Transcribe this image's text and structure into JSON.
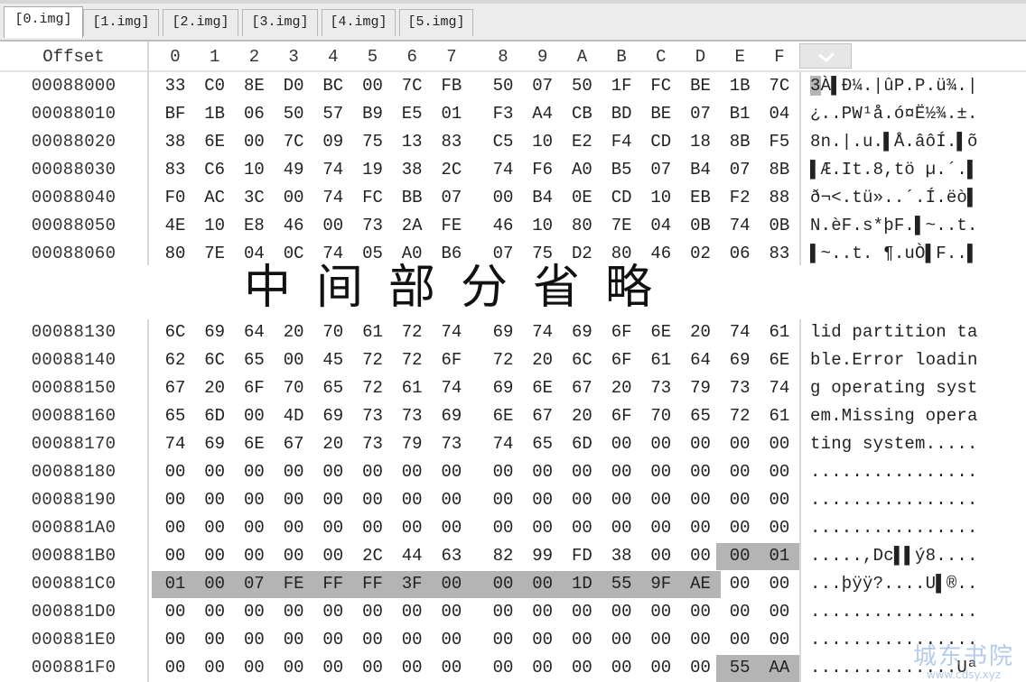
{
  "tabs": [
    {
      "label": "[0.img]",
      "active": true
    },
    {
      "label": "[1.img]",
      "active": false
    },
    {
      "label": "[2.img]",
      "active": false
    },
    {
      "label": "[3.img]",
      "active": false
    },
    {
      "label": "[4.img]",
      "active": false
    },
    {
      "label": "[5.img]",
      "active": false
    }
  ],
  "header": {
    "offset_label": "Offset",
    "columns": [
      "0",
      "1",
      "2",
      "3",
      "4",
      "5",
      "6",
      "7",
      "8",
      "9",
      "A",
      "B",
      "C",
      "D",
      "E",
      "F"
    ],
    "menu_icon": "chevron-down-icon"
  },
  "top_rows": [
    {
      "offset": "00088000",
      "bytes": [
        "33",
        "C0",
        "8E",
        "D0",
        "BC",
        "00",
        "7C",
        "FB",
        "50",
        "07",
        "50",
        "1F",
        "FC",
        "BE",
        "1B",
        "7C"
      ],
      "ascii": "3À▌Ð¼.|ûP.P.ü¾.|"
    },
    {
      "offset": "00088010",
      "bytes": [
        "BF",
        "1B",
        "06",
        "50",
        "57",
        "B9",
        "E5",
        "01",
        "F3",
        "A4",
        "CB",
        "BD",
        "BE",
        "07",
        "B1",
        "04"
      ],
      "ascii": "¿..PW¹å.ó¤Ë½¾.±."
    },
    {
      "offset": "00088020",
      "bytes": [
        "38",
        "6E",
        "00",
        "7C",
        "09",
        "75",
        "13",
        "83",
        "C5",
        "10",
        "E2",
        "F4",
        "CD",
        "18",
        "8B",
        "F5"
      ],
      "ascii": "8n.|.u.▌Å.âôÍ.▌õ"
    },
    {
      "offset": "00088030",
      "bytes": [
        "83",
        "C6",
        "10",
        "49",
        "74",
        "19",
        "38",
        "2C",
        "74",
        "F6",
        "A0",
        "B5",
        "07",
        "B4",
        "07",
        "8B"
      ],
      "ascii": "▌Æ.It.8,tö µ.´.▌"
    },
    {
      "offset": "00088040",
      "bytes": [
        "F0",
        "AC",
        "3C",
        "00",
        "74",
        "FC",
        "BB",
        "07",
        "00",
        "B4",
        "0E",
        "CD",
        "10",
        "EB",
        "F2",
        "88"
      ],
      "ascii": "ð¬<.tü»..´.Í.ëò▌"
    },
    {
      "offset": "00088050",
      "bytes": [
        "4E",
        "10",
        "E8",
        "46",
        "00",
        "73",
        "2A",
        "FE",
        "46",
        "10",
        "80",
        "7E",
        "04",
        "0B",
        "74",
        "0B"
      ],
      "ascii": "N.èF.s*þF.▌~..t."
    },
    {
      "offset": "00088060",
      "bytes": [
        "80",
        "7E",
        "04",
        "0C",
        "74",
        "05",
        "A0",
        "B6",
        "07",
        "75",
        "D2",
        "80",
        "46",
        "02",
        "06",
        "83"
      ],
      "ascii": "▌~..t. ¶.uÒ▌F..▌"
    }
  ],
  "omitted_label": "中间部分省略",
  "bottom_rows": [
    {
      "offset": "00088130",
      "bytes": [
        "6C",
        "69",
        "64",
        "20",
        "70",
        "61",
        "72",
        "74",
        "69",
        "74",
        "69",
        "6F",
        "6E",
        "20",
        "74",
        "61"
      ],
      "ascii": "lid partition ta"
    },
    {
      "offset": "00088140",
      "bytes": [
        "62",
        "6C",
        "65",
        "00",
        "45",
        "72",
        "72",
        "6F",
        "72",
        "20",
        "6C",
        "6F",
        "61",
        "64",
        "69",
        "6E"
      ],
      "ascii": "ble.Error loadin"
    },
    {
      "offset": "00088150",
      "bytes": [
        "67",
        "20",
        "6F",
        "70",
        "65",
        "72",
        "61",
        "74",
        "69",
        "6E",
        "67",
        "20",
        "73",
        "79",
        "73",
        "74"
      ],
      "ascii": "g operating syst"
    },
    {
      "offset": "00088160",
      "bytes": [
        "65",
        "6D",
        "00",
        "4D",
        "69",
        "73",
        "73",
        "69",
        "6E",
        "67",
        "20",
        "6F",
        "70",
        "65",
        "72",
        "61"
      ],
      "ascii": "em.Missing opera"
    },
    {
      "offset": "00088170",
      "bytes": [
        "74",
        "69",
        "6E",
        "67",
        "20",
        "73",
        "79",
        "73",
        "74",
        "65",
        "6D",
        "00",
        "00",
        "00",
        "00",
        "00"
      ],
      "ascii": "ting system....."
    },
    {
      "offset": "00088180",
      "bytes": [
        "00",
        "00",
        "00",
        "00",
        "00",
        "00",
        "00",
        "00",
        "00",
        "00",
        "00",
        "00",
        "00",
        "00",
        "00",
        "00"
      ],
      "ascii": "................"
    },
    {
      "offset": "00088190",
      "bytes": [
        "00",
        "00",
        "00",
        "00",
        "00",
        "00",
        "00",
        "00",
        "00",
        "00",
        "00",
        "00",
        "00",
        "00",
        "00",
        "00"
      ],
      "ascii": "................"
    },
    {
      "offset": "000881A0",
      "bytes": [
        "00",
        "00",
        "00",
        "00",
        "00",
        "00",
        "00",
        "00",
        "00",
        "00",
        "00",
        "00",
        "00",
        "00",
        "00",
        "00"
      ],
      "ascii": "................"
    },
    {
      "offset": "000881B0",
      "bytes": [
        "00",
        "00",
        "00",
        "00",
        "00",
        "2C",
        "44",
        "63",
        "82",
        "99",
        "FD",
        "38",
        "00",
        "00",
        "00",
        "01"
      ],
      "ascii": ".....,Dc▌▌ý8...."
    },
    {
      "offset": "000881C0",
      "bytes": [
        "01",
        "00",
        "07",
        "FE",
        "FF",
        "FF",
        "3F",
        "00",
        "00",
        "00",
        "1D",
        "55",
        "9F",
        "AE",
        "00",
        "00"
      ],
      "ascii": "...þÿÿ?....U▌®.."
    },
    {
      "offset": "000881D0",
      "bytes": [
        "00",
        "00",
        "00",
        "00",
        "00",
        "00",
        "00",
        "00",
        "00",
        "00",
        "00",
        "00",
        "00",
        "00",
        "00",
        "00"
      ],
      "ascii": "................"
    },
    {
      "offset": "000881E0",
      "bytes": [
        "00",
        "00",
        "00",
        "00",
        "00",
        "00",
        "00",
        "00",
        "00",
        "00",
        "00",
        "00",
        "00",
        "00",
        "00",
        "00"
      ],
      "ascii": "................"
    },
    {
      "offset": "000881F0",
      "bytes": [
        "00",
        "00",
        "00",
        "00",
        "00",
        "00",
        "00",
        "00",
        "00",
        "00",
        "00",
        "00",
        "00",
        "00",
        "55",
        "AA"
      ],
      "ascii": "..............Uª"
    }
  ],
  "highlights": [
    {
      "row": "000881B0",
      "from": 14,
      "to": 15
    },
    {
      "row": "000881C0",
      "from": 0,
      "to": 13
    },
    {
      "row": "000881F0",
      "from": 14,
      "to": 15
    }
  ],
  "colors": {
    "highlight": "#b4b4b4",
    "background": "#ffffff",
    "tabbar": "#ececec"
  },
  "watermark": {
    "text": "城东书院",
    "url": "www.cdsy.xyz"
  }
}
